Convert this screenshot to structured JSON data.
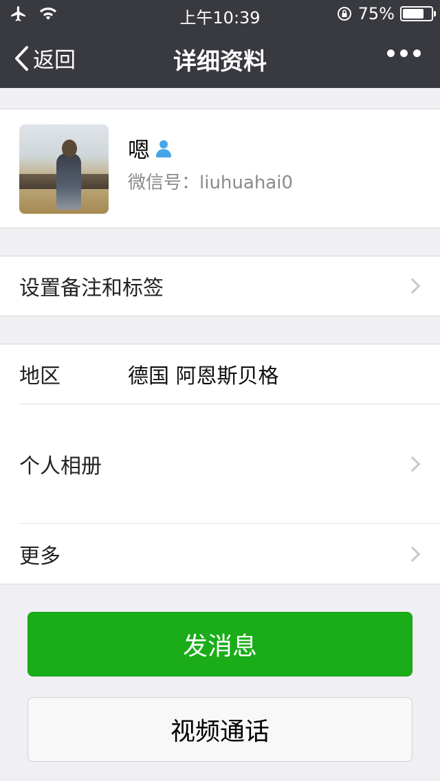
{
  "status_bar": {
    "time": "上午10:39",
    "battery_percent": "75%",
    "battery_level": 0.75
  },
  "nav": {
    "back_label": "返回",
    "title": "详细资料"
  },
  "profile": {
    "name": "嗯",
    "wechat_id": "微信号：liuhuahai0"
  },
  "remark_row": {
    "label": "设置备注和标签"
  },
  "info": {
    "region_label": "地区",
    "region_value": "德国 阿恩斯贝格",
    "album_label": "个人相册",
    "more_label": "更多"
  },
  "actions": {
    "send_message": "发消息",
    "video_call": "视频通话"
  },
  "colors": {
    "nav_bg": "#393a3f",
    "primary_green": "#1aad19",
    "background": "#efeff4"
  }
}
